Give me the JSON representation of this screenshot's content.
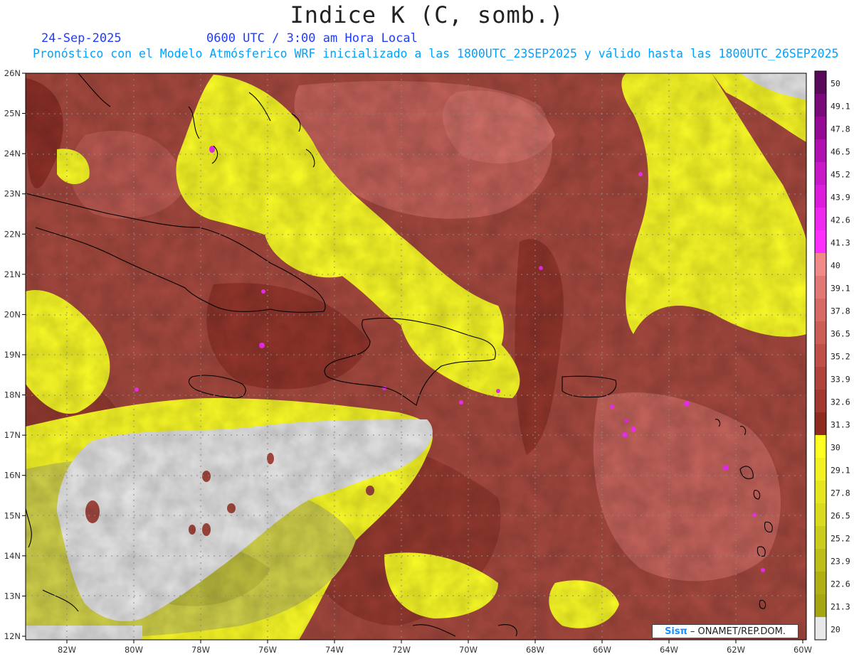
{
  "header": {
    "title": "Indice K (C, somb.)",
    "date": "24-Sep-2025",
    "time": "0600 UTC / 3:00 am Hora Local",
    "subtitle": "Pronóstico con el Modelo Atmósferico WRF inicializado a las 1800UTC_23SEP2025 y válido hasta las  1800UTC_26SEP2025"
  },
  "map": {
    "lat_labels": [
      "26N",
      "25N",
      "24N",
      "23N",
      "22N",
      "21N",
      "20N",
      "19N",
      "18N",
      "17N",
      "16N",
      "15N",
      "14N",
      "13N",
      "12N"
    ],
    "lon_labels": [
      "82W",
      "80W",
      "78W",
      "76W",
      "74W",
      "72W",
      "70W",
      "68W",
      "66W",
      "64W",
      "62W",
      "60W"
    ]
  },
  "colorbar": {
    "levels": [
      "50",
      "49.1",
      "47.8",
      "46.5",
      "45.2",
      "43.9",
      "42.6",
      "41.3",
      "40",
      "39.1",
      "37.8",
      "36.5",
      "35.2",
      "33.9",
      "32.6",
      "31.3",
      "30",
      "29.1",
      "27.8",
      "26.5",
      "25.2",
      "23.9",
      "22.6",
      "21.3",
      "20"
    ],
    "colors": [
      "#5a0a5a",
      "#7a0a7a",
      "#950a95",
      "#b010b0",
      "#c818c8",
      "#dc1edc",
      "#ee28ee",
      "#ff30ff",
      "#f08a88",
      "#e27876",
      "#d86a66",
      "#cc5e58",
      "#be5048",
      "#b0443c",
      "#a23830",
      "#8e2c22",
      "#ffff22",
      "#f2f222",
      "#e6e620",
      "#dada1e",
      "#cccc1c",
      "#bebe18",
      "#b0b014",
      "#a6a612",
      "#e8e8e8"
    ]
  },
  "credit": {
    "brand": "Sisπ",
    "text": "– ONAMET/REP.DOM."
  },
  "colors": {
    "field_high": "#b8584e",
    "field_mid": "#9a4038",
    "field_yellow": "#ffff2a",
    "field_olive": "#d2d24a",
    "missing": "#e8e8e8",
    "coast": "#000000"
  }
}
